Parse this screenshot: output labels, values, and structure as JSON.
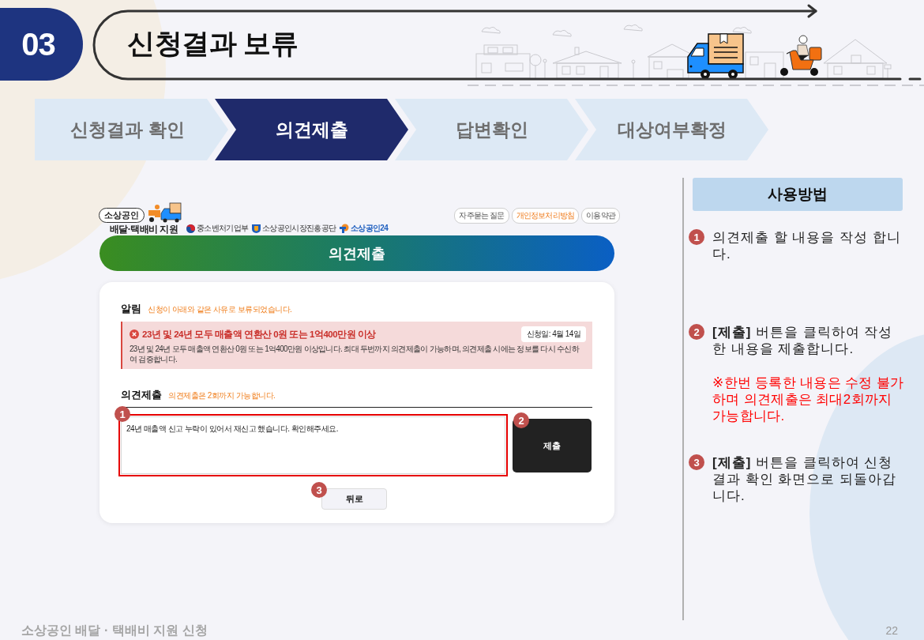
{
  "header": {
    "number": "03",
    "title": "신청결과 보류"
  },
  "steps": [
    {
      "label": "신청결과 확인",
      "selected": false
    },
    {
      "label": "의견제출",
      "selected": true
    },
    {
      "label": "답변확인",
      "selected": false
    },
    {
      "label": "대상여부확정",
      "selected": false
    }
  ],
  "screenshot": {
    "logo": {
      "badge": "소상공인",
      "name": "배달·택배비 지원"
    },
    "partners": [
      {
        "name": "중소벤처기업부",
        "kind": "ministry"
      },
      {
        "name": "소상공인시장진흥공단",
        "kind": "agency"
      },
      {
        "name": "소상공인24",
        "kind": "portal"
      }
    ],
    "links": [
      {
        "label": "자주묻는 질문",
        "kind": "plain"
      },
      {
        "label": "개인정보처리방침",
        "kind": "accent"
      },
      {
        "label": "이용약관",
        "kind": "plain"
      }
    ],
    "banner": "의견제출",
    "notice": {
      "heading": "알림",
      "hint": "신청이 아래와 같은 사유로 보류되었습니다.",
      "alert": {
        "title": "23년 및 24년 모두 매출액 연환산 0원 또는 1억400만원 이상",
        "date": "신청일: 4월 14일",
        "body": "23년 및 24년 모두 매출액 연환산 0원 또는 1억400만원 이상입니다. 최대 두번까지 의견제출이 가능하며, 의견제출 시에는 정보를 다시 수신하여 검증합니다."
      }
    },
    "opinion": {
      "heading": "의견제출",
      "hint": "의견제출은 2회까지 가능합니다.",
      "value": "24년 매출액 신고 누락이 있어서 재신고 했습니다. 확인해주세요.",
      "submit": "제출",
      "back": "뒤로"
    },
    "markers": [
      "1",
      "2",
      "3"
    ]
  },
  "guide": {
    "title": "사용방법",
    "items": [
      {
        "number": "1",
        "text": "의견제출 할 내용을 작성 합니다."
      },
      {
        "number": "2",
        "text": "**[제출]** 버튼을 클릭하여 작성한 내용을 제출합니다.",
        "note": "※한번 등록한 내용은 수정 불가하며 의견제출은 최대2회까지 가능합니다."
      },
      {
        "number": "3",
        "text": "**[제출]** 버튼을 클릭하여 신청결과 확인 화면으로 되돌아갑니다."
      }
    ]
  },
  "footer": {
    "title": "소상공인 배달 · 택배비 지원 신청",
    "page": "22"
  }
}
